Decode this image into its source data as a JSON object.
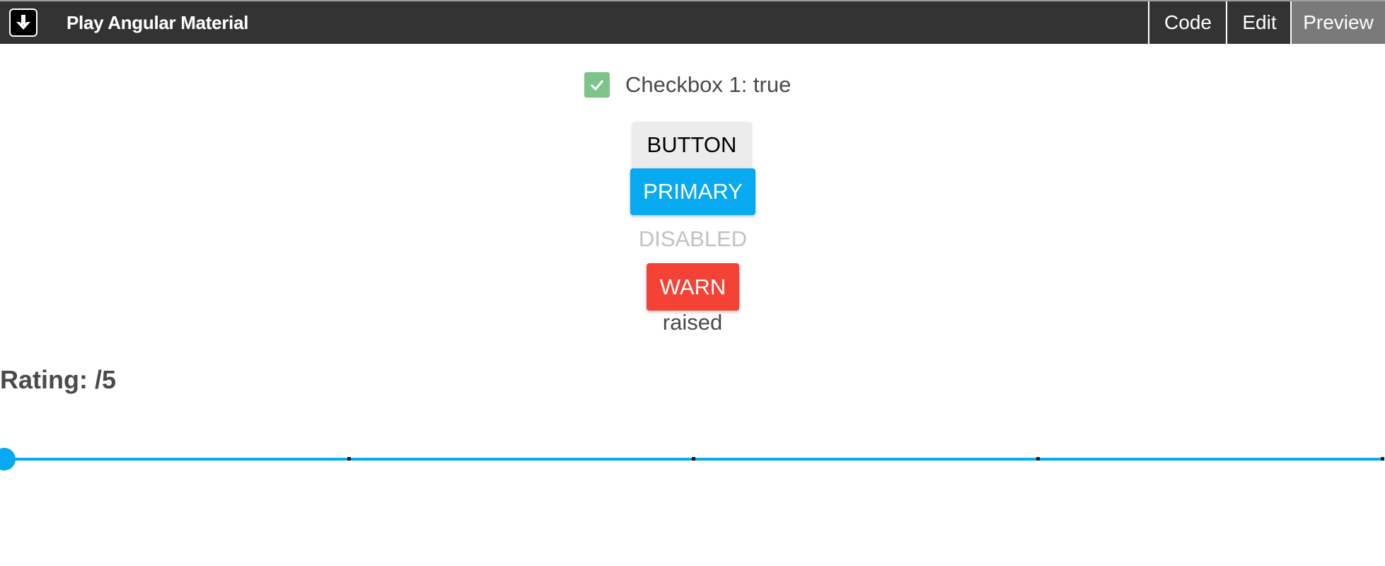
{
  "header": {
    "logo_icon": "download-arrow-icon",
    "title": "Play Angular Material",
    "tabs": [
      {
        "label": "Code",
        "active": false
      },
      {
        "label": "Edit",
        "active": false
      },
      {
        "label": "Preview",
        "active": true
      }
    ]
  },
  "checkbox": {
    "checked": true,
    "label": "Checkbox 1: true"
  },
  "buttons": {
    "default_label": "BUTTON",
    "primary_label": "PRIMARY",
    "disabled_label": "DISABLED",
    "warn_label": "WARN",
    "caption": "raised"
  },
  "rating": {
    "heading": "Rating: /5",
    "slider_min": 0,
    "slider_max": 4,
    "slider_step": 1,
    "slider_value": 0
  },
  "colors": {
    "accent": "#07a9f0",
    "warn": "#f44336",
    "checkbox": "#7cc48a",
    "topbar": "#333333"
  }
}
